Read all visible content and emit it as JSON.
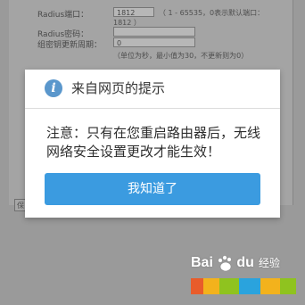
{
  "form": {
    "radius_port_label": "Radius端口：",
    "radius_port_value": "1812",
    "radius_port_hint": "（ 1 - 65535，0表示默认端口：",
    "radius_port_hint2": "1812 ）",
    "radius_password_label": "Radius密码：",
    "radius_password_value": "",
    "group_key_label": "组密钥更新周期：",
    "group_key_value": "0",
    "group_key_hint": "（单位为秒，最小值为30，不更新则为0）",
    "save_button_label": "保"
  },
  "dialog": {
    "title": "来自网页的提示",
    "icon": "info-icon",
    "message": "注意：只有在您重启路由器后，无线网络安全设置更改才能生效！",
    "ok_button": "我知道了",
    "accent_color": "#3b9be0"
  },
  "watermark": {
    "brand": "Bai",
    "brand2": "du",
    "suffix": "经验"
  }
}
